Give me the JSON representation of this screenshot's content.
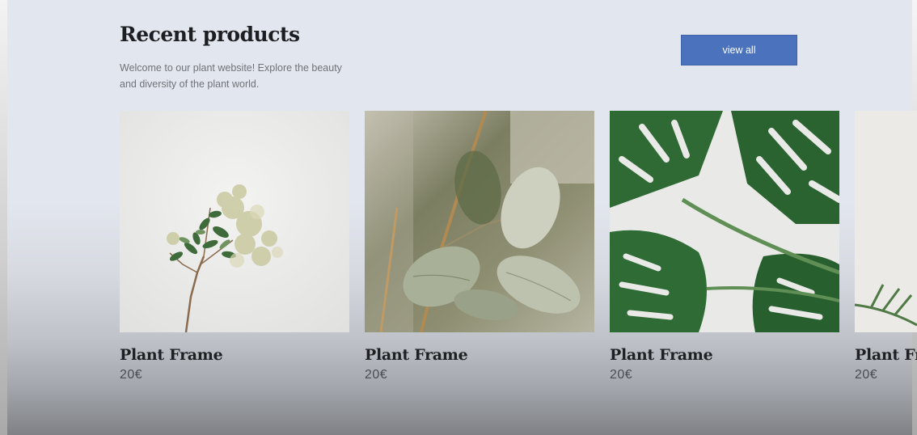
{
  "section": {
    "title": "Recent products",
    "description": "Welcome to our plant website! Explore the beauty and diversity of the plant world.",
    "view_all_label": "view all"
  },
  "products": [
    {
      "name": "Plant Frame",
      "price": "20€",
      "image": "flowering-branch-photo"
    },
    {
      "name": "Plant Frame",
      "price": "20€",
      "image": "eucalyptus-leaves-photo"
    },
    {
      "name": "Plant Frame",
      "price": "20€",
      "image": "monstera-leaves-photo"
    },
    {
      "name": "Plant Frame",
      "price": "20€",
      "image": "palm-leaf-photo"
    }
  ],
  "colors": {
    "accent": "#4a72bd",
    "background": "#e2e6ee",
    "heading": "#1c1e22"
  }
}
